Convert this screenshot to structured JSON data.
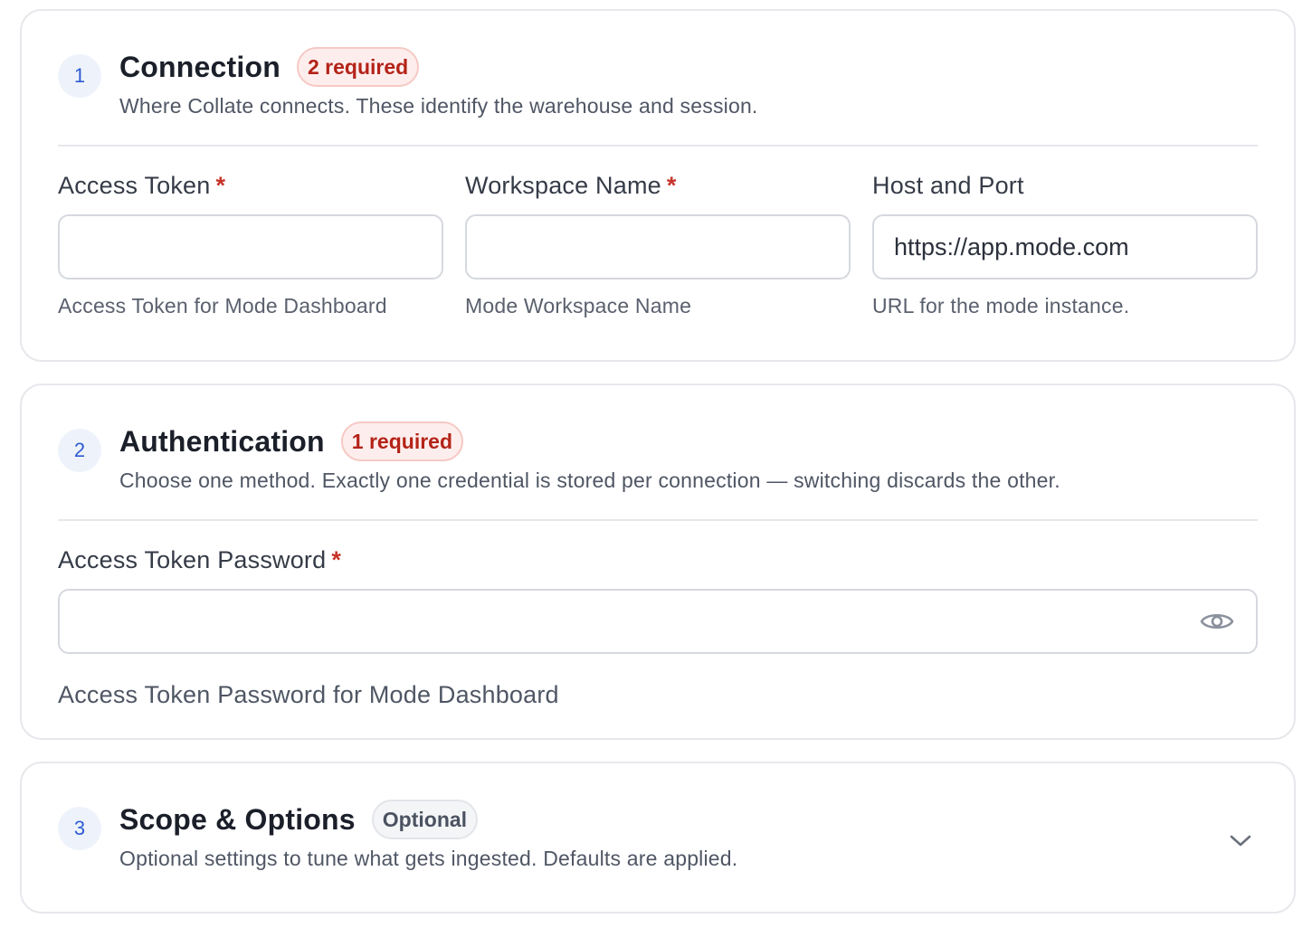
{
  "sections": [
    {
      "number": "1",
      "title": "Connection",
      "badge": "2 required",
      "subtitle": "Where Collate connects. These identify the warehouse and session.",
      "fields": [
        {
          "label": "Access Token",
          "required_mark": "*",
          "value": "",
          "help": "Access Token for Mode Dashboard"
        },
        {
          "label": "Workspace Name",
          "required_mark": "*",
          "value": "",
          "help": "Mode Workspace Name"
        },
        {
          "label": "Host and Port",
          "value": "https://app.mode.com",
          "help": "URL for the mode instance."
        }
      ]
    },
    {
      "number": "2",
      "title": "Authentication",
      "badge": "1 required",
      "subtitle": "Choose one method. Exactly one credential is stored per connection — switching discards the other.",
      "fields": [
        {
          "label": "Access Token Password",
          "required_mark": "*",
          "value": "",
          "help": "Access Token Password for Mode Dashboard",
          "icon": "eye-icon"
        }
      ]
    },
    {
      "number": "3",
      "title": "Scope & Options",
      "badge": "Optional",
      "subtitle": "Optional settings to tune what gets ingested. Defaults are applied.",
      "icon": "chevron-down-icon"
    }
  ],
  "colors": {
    "accent": "#2d5bd1",
    "required": "#c7342a",
    "border": "#e6e8ec"
  }
}
